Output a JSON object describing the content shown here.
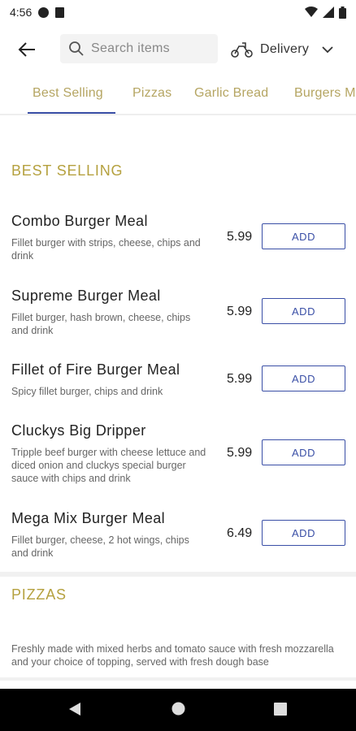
{
  "status": {
    "time": "4:56"
  },
  "search": {
    "placeholder": "Search items"
  },
  "delivery": {
    "label": "Delivery"
  },
  "tabs": [
    "Best Selling",
    "Pizzas",
    "Garlic Bread",
    "Burgers M"
  ],
  "sections": {
    "best_selling": "BEST SELLING",
    "pizzas": "PIZZAS",
    "pizzas_desc": "Freshly made with mixed herbs and tomato sauce with fresh mozzarella and your choice of topping, served with fresh dough base"
  },
  "items": [
    {
      "name": "Combo Burger Meal",
      "desc": "Fillet burger with strips, cheese, chips and drink",
      "price": "5.99",
      "button": "ADD"
    },
    {
      "name": "Supreme Burger Meal",
      "desc": "Fillet burger, hash brown, cheese, chips and drink",
      "price": "5.99",
      "button": "ADD"
    },
    {
      "name": "Fillet of Fire Burger Meal",
      "desc": "Spicy fillet burger, chips and drink",
      "price": "5.99",
      "button": "ADD"
    },
    {
      "name": "Cluckys Big Dripper",
      "desc": "Tripple beef burger with cheese lettuce and diced onion and cluckys special burger sauce with chips and drink",
      "price": "5.99",
      "button": "ADD"
    },
    {
      "name": "Mega Mix Burger Meal",
      "desc": "Fillet burger, cheese, 2 hot wings, chips and drink",
      "price": "6.49",
      "button": "ADD"
    }
  ],
  "colors": {
    "accent": "#3a4fa6",
    "gold": "#b5a13f"
  }
}
